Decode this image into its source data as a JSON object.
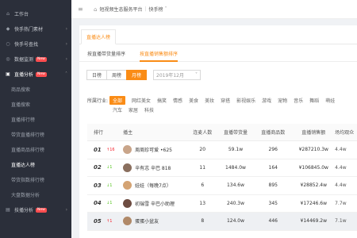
{
  "sidebar": {
    "items": [
      {
        "label": "工作台",
        "icon": "home-icon"
      },
      {
        "label": "快手热门素材",
        "icon": "fire-icon"
      },
      {
        "label": "快手号查找",
        "icon": "search-icon"
      },
      {
        "label": "数据监测",
        "icon": "monitor-icon",
        "badge": "New"
      },
      {
        "label": "直播分析",
        "icon": "live-icon",
        "badge": "New"
      }
    ],
    "sub_items": [
      {
        "label": "商品搜索"
      },
      {
        "label": "直播搜索"
      },
      {
        "label": "直播排行榜"
      },
      {
        "label": "带货直播排行榜"
      },
      {
        "label": "直播商品排行榜"
      },
      {
        "label": "直播达人榜"
      },
      {
        "label": "带货指数排行榜"
      },
      {
        "label": "大盘数据分析"
      }
    ],
    "bottom_item": {
      "label": "技播分析",
      "badge": "New"
    }
  },
  "topbar": {
    "breadcrumb_root": "短视频生态服务平台",
    "breadcrumb_current": "快手榜"
  },
  "tabs_primary": [
    "直播达人榜"
  ],
  "tabs_secondary": [
    "按直播带货量排序",
    "按直播销售额排序"
  ],
  "period": {
    "options": [
      "日榜",
      "周榜",
      "月榜"
    ],
    "selected": "月榜",
    "month_value": "2019年12月"
  },
  "industry": {
    "label": "所属行业:",
    "row1": [
      "全部",
      "网红美女",
      "搞笑",
      "情感",
      "美食",
      "美妆",
      "穿搭",
      "影视娱乐",
      "游戏",
      "宠物",
      "音乐",
      "舞蹈",
      "萌娃"
    ],
    "row2": [
      "汽车",
      "家居",
      "科技"
    ],
    "selected": "全部"
  },
  "table": {
    "headers": [
      "排行",
      "播主",
      "连麦人数",
      "直播带货量",
      "直播商品数",
      "直播销售额",
      "场均观众"
    ],
    "rows": [
      {
        "rank": "01",
        "change": "↑16",
        "dir": "up",
        "host": "周周珍可爱 •625",
        "fans": "20",
        "uv": "59.1w",
        "goods": "296",
        "sales": "¥287210.3w",
        "conv": "4.4w",
        "avatar": "#c9a58a"
      },
      {
        "rank": "02",
        "change": "↓1",
        "dir": "down",
        "host": "辛有志 辛巴 818",
        "fans": "11",
        "uv": "1484.0w",
        "goods": "164",
        "sales": "¥106845.0w",
        "conv": "4.4w",
        "avatar": "#8a6f5e"
      },
      {
        "rank": "03",
        "change": "↓1",
        "dir": "down",
        "host": "娃娃（每晚7点）",
        "fans": "6",
        "uv": "134.6w",
        "goods": "895",
        "sales": "¥28852.4w",
        "conv": "4.4w",
        "avatar": "#d4a373"
      },
      {
        "rank": "04",
        "change": "↓1",
        "dir": "down",
        "host": "初瑞雪 辛巴小助理",
        "fans": "13",
        "uv": "240.3w",
        "goods": "345",
        "sales": "¥17246.6w",
        "conv": "7.7w",
        "avatar": "#6d4c41"
      },
      {
        "rank": "05",
        "change": "↑1",
        "dir": "up",
        "host": "蛋蛋小盆友",
        "fans": "8",
        "uv": "124.0w",
        "goods": "446",
        "sales": "¥14469.2w",
        "conv": "7.1w",
        "avatar": "#b08968"
      }
    ]
  }
}
